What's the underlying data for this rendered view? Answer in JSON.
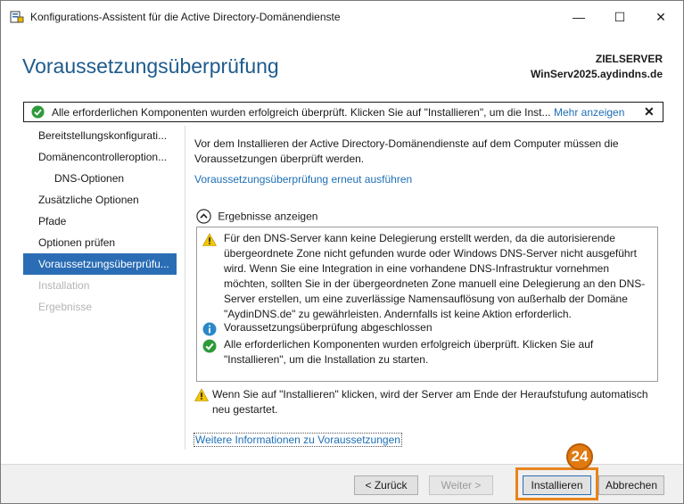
{
  "window": {
    "title": "Konfigurations-Assistent für die Active Directory-Domänendienste",
    "minimize_glyph": "—",
    "maximize_glyph": "☐",
    "close_glyph": "✕"
  },
  "header": {
    "page_title": "Voraussetzungsüberprüfung",
    "server_label": "ZIELSERVER",
    "server_name": "WinServ2025.aydindns.de"
  },
  "notification": {
    "text": "Alle erforderlichen Komponenten wurden erfolgreich überprüft. Klicken Sie auf \"Installieren\", um die Inst...",
    "more_link": "Mehr anzeigen",
    "close_glyph": "✕"
  },
  "nav": {
    "items": [
      {
        "label": "Bereitstellungskonfigurati...",
        "state": "normal"
      },
      {
        "label": "Domänencontrolleroption...",
        "state": "normal"
      },
      {
        "label": "DNS-Optionen",
        "state": "sub"
      },
      {
        "label": "Zusätzliche Optionen",
        "state": "normal"
      },
      {
        "label": "Pfade",
        "state": "normal"
      },
      {
        "label": "Optionen prüfen",
        "state": "normal"
      },
      {
        "label": "Voraussetzungsüberprüfu...",
        "state": "active"
      },
      {
        "label": "Installation",
        "state": "disabled"
      },
      {
        "label": "Ergebnisse",
        "state": "disabled"
      }
    ]
  },
  "main": {
    "intro": "Vor dem Installieren der Active Directory-Domänendienste auf dem Computer müssen die Voraussetzungen überprüft werden.",
    "rerun_link": "Voraussetzungsüberprüfung erneut ausführen",
    "results_toggle": "Ergebnisse anzeigen",
    "results": [
      {
        "icon": "warning-icon",
        "text": "Für den DNS-Server kann keine Delegierung erstellt werden, da die autorisierende übergeordnete Zone nicht gefunden wurde oder Windows DNS-Server nicht ausgeführt wird. Wenn Sie eine Integration in eine vorhandene DNS-Infrastruktur vornehmen möchten, sollten Sie in der übergeordneten Zone manuell eine Delegierung an den DNS-Server erstellen, um eine zuverlässige Namensauflösung von außerhalb der Domäne \"AydinDNS.de\" zu gewährleisten. Andernfalls ist keine Aktion erforderlich."
      },
      {
        "icon": "info-icon",
        "text": "Voraussetzungsüberprüfung abgeschlossen"
      },
      {
        "icon": "success-icon",
        "text": "Alle erforderlichen Komponenten wurden erfolgreich überprüft. Klicken Sie auf \"Installieren\", um die Installation zu starten."
      }
    ],
    "warning_note": "Wenn Sie auf \"Installieren\" klicken, wird der Server am Ende der Heraufstufung automatisch neu gestartet.",
    "more_info_link": "Weitere Informationen zu Voraussetzungen"
  },
  "footer": {
    "back": "< Zurück",
    "next": "Weiter >",
    "install": "Installieren",
    "cancel": "Abbrechen"
  },
  "annotation": {
    "step_number": "24",
    "highlight_color": "#e8841c"
  },
  "colors": {
    "heading_blue": "#1e5b8c",
    "link_blue": "#1e6fb5",
    "active_nav": "#2a6db5",
    "warning_yellow": "#f2c500",
    "success_green": "#2e9a3a",
    "info_blue": "#2a88c8"
  }
}
